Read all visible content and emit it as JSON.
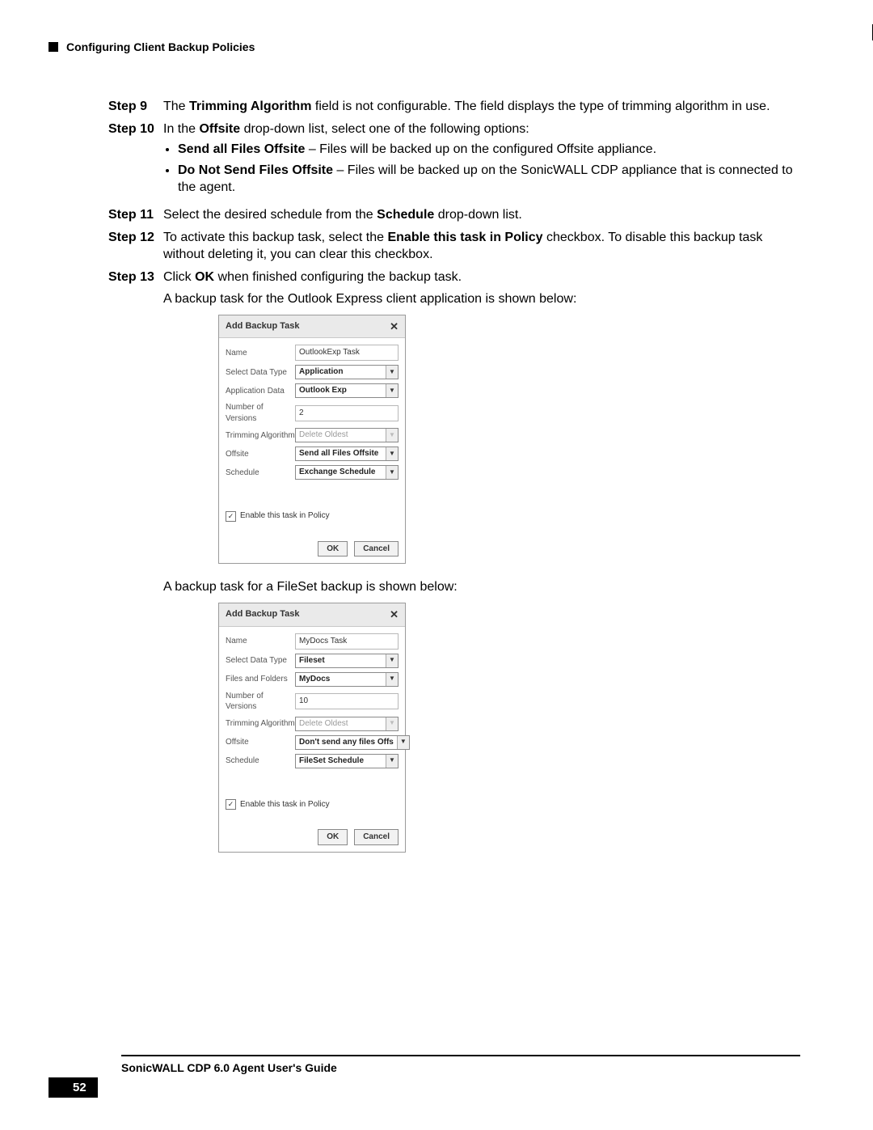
{
  "header": {
    "section_title": "Configuring Client Backup Policies"
  },
  "steps": {
    "s9": {
      "label": "Step 9",
      "pre": "The ",
      "bold1": "Trimming Algorithm",
      "post": " field is not configurable. The field displays the type of trimming algorithm in use."
    },
    "s10": {
      "label": "Step 10",
      "pre": "In the ",
      "bold1": "Offsite",
      "post": " drop-down list, select one of the following options:",
      "bullets": [
        {
          "b": "Send all Files Offsite",
          "rest": " – Files will be backed up on the configured Offsite appliance."
        },
        {
          "b": "Do Not Send Files Offsite",
          "rest": " – Files will be backed up on the SonicWALL CDP appliance that is connected to the agent."
        }
      ]
    },
    "s11": {
      "label": "Step 11",
      "pre": "Select the desired schedule from the ",
      "bold1": "Schedule",
      "post": " drop-down list."
    },
    "s12": {
      "label": "Step 12",
      "pre": "To activate this backup task, select the ",
      "bold1": "Enable this task in Policy",
      "post": " checkbox. To disable this backup task without deleting it, you can clear this checkbox."
    },
    "s13": {
      "label": "Step 13",
      "pre": "Click ",
      "bold1": "OK",
      "post": " when finished configuring the backup task."
    },
    "caption1": "A backup task for the Outlook Express client application is shown below:",
    "caption2": "A backup task for a FileSet backup is shown below:"
  },
  "dialog_labels": {
    "title": "Add Backup Task",
    "name": "Name",
    "select_data_type": "Select Data Type",
    "app_data": "Application Data",
    "files_folders": "Files and Folders",
    "num_versions": "Number of Versions",
    "trim_alg": "Trimming Algorithm",
    "offsite": "Offsite",
    "schedule": "Schedule",
    "enable": "Enable this task in Policy",
    "ok": "OK",
    "cancel": "Cancel",
    "check": "✓"
  },
  "dialog1": {
    "name": "OutlookExp Task",
    "data_type": "Application",
    "app_data": "Outlook Exp",
    "versions": "2",
    "trim": "Delete Oldest",
    "offsite": "Send all Files Offsite",
    "schedule": "Exchange Schedule"
  },
  "dialog2": {
    "name": "MyDocs Task",
    "data_type": "Fileset",
    "files_folders": "MyDocs",
    "versions": "10",
    "trim": "Delete Oldest",
    "offsite": "Don't send any files Offs",
    "schedule": "FileSet Schedule"
  },
  "footer": {
    "guide": "SonicWALL CDP 6.0 Agent User's Guide",
    "page": "52"
  }
}
